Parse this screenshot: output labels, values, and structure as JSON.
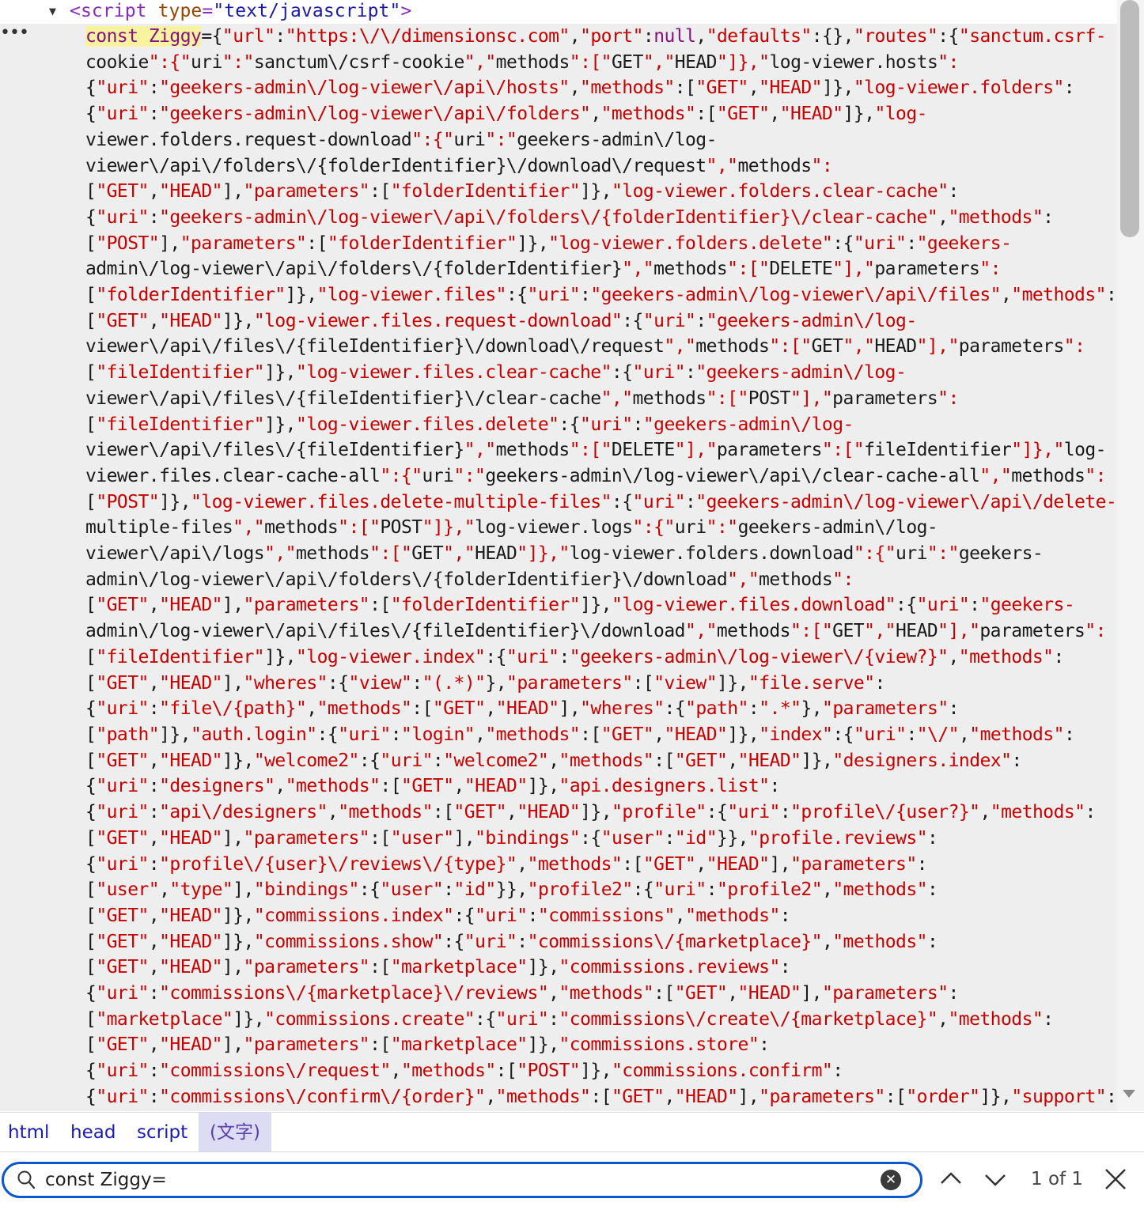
{
  "source_tag": {
    "open": "<script",
    "attr_name": "type",
    "eq": "=",
    "attr_value": "\"text/javascript\"",
    "close": ">"
  },
  "code": {
    "keyword": "const",
    "identifier": "Ziggy",
    "lines": [
      "={\"url\":\"https:\\/\\/dimensionsc.com\",\"port\":null,\"defaults\":{},\"routes\":{\"sanctum.csrf-",
      "cookie\":{\"uri\":\"sanctum\\/csrf-cookie\",\"methods\":[\"GET\",\"HEAD\"]},\"log-viewer.hosts\":",
      "{\"uri\":\"geekers-admin\\/log-viewer\\/api\\/hosts\",\"methods\":[\"GET\",\"HEAD\"]},\"log-viewer.folders\":",
      "{\"uri\":\"geekers-admin\\/log-viewer\\/api\\/folders\",\"methods\":[\"GET\",\"HEAD\"]},\"log-",
      "viewer.folders.request-download\":{\"uri\":\"geekers-admin\\/log-",
      "viewer\\/api\\/folders\\/{folderIdentifier}\\/download\\/request\",\"methods\":",
      "[\"GET\",\"HEAD\"],\"parameters\":[\"folderIdentifier\"]},\"log-viewer.folders.clear-cache\":",
      "{\"uri\":\"geekers-admin\\/log-viewer\\/api\\/folders\\/{folderIdentifier}\\/clear-cache\",\"methods\":",
      "[\"POST\"],\"parameters\":[\"folderIdentifier\"]},\"log-viewer.folders.delete\":{\"uri\":\"geekers-",
      "admin\\/log-viewer\\/api\\/folders\\/{folderIdentifier}\",\"methods\":[\"DELETE\"],\"parameters\":",
      "[\"folderIdentifier\"]},\"log-viewer.files\":{\"uri\":\"geekers-admin\\/log-viewer\\/api\\/files\",\"methods\":",
      "[\"GET\",\"HEAD\"]},\"log-viewer.files.request-download\":{\"uri\":\"geekers-admin\\/log-",
      "viewer\\/api\\/files\\/{fileIdentifier}\\/download\\/request\",\"methods\":[\"GET\",\"HEAD\"],\"parameters\":",
      "[\"fileIdentifier\"]},\"log-viewer.files.clear-cache\":{\"uri\":\"geekers-admin\\/log-",
      "viewer\\/api\\/files\\/{fileIdentifier}\\/clear-cache\",\"methods\":[\"POST\"],\"parameters\":",
      "[\"fileIdentifier\"]},\"log-viewer.files.delete\":{\"uri\":\"geekers-admin\\/log-",
      "viewer\\/api\\/files\\/{fileIdentifier}\",\"methods\":[\"DELETE\"],\"parameters\":[\"fileIdentifier\"]},\"log-",
      "viewer.files.clear-cache-all\":{\"uri\":\"geekers-admin\\/log-viewer\\/api\\/clear-cache-all\",\"methods\":",
      "[\"POST\"]},\"log-viewer.files.delete-multiple-files\":{\"uri\":\"geekers-admin\\/log-viewer\\/api\\/delete-",
      "multiple-files\",\"methods\":[\"POST\"]},\"log-viewer.logs\":{\"uri\":\"geekers-admin\\/log-",
      "viewer\\/api\\/logs\",\"methods\":[\"GET\",\"HEAD\"]},\"log-viewer.folders.download\":{\"uri\":\"geekers-",
      "admin\\/log-viewer\\/api\\/folders\\/{folderIdentifier}\\/download\",\"methods\":",
      "[\"GET\",\"HEAD\"],\"parameters\":[\"folderIdentifier\"]},\"log-viewer.files.download\":{\"uri\":\"geekers-",
      "admin\\/log-viewer\\/api\\/files\\/{fileIdentifier}\\/download\",\"methods\":[\"GET\",\"HEAD\"],\"parameters\":",
      "[\"fileIdentifier\"]},\"log-viewer.index\":{\"uri\":\"geekers-admin\\/log-viewer\\/{view?}\",\"methods\":",
      "[\"GET\",\"HEAD\"],\"wheres\":{\"view\":\"(.*)\"},\"parameters\":[\"view\"]},\"file.serve\":",
      "{\"uri\":\"file\\/{path}\",\"methods\":[\"GET\",\"HEAD\"],\"wheres\":{\"path\":\".*\"},\"parameters\":",
      "[\"path\"]},\"auth.login\":{\"uri\":\"login\",\"methods\":[\"GET\",\"HEAD\"]},\"index\":{\"uri\":\"\\/\",\"methods\":",
      "[\"GET\",\"HEAD\"]},\"welcome2\":{\"uri\":\"welcome2\",\"methods\":[\"GET\",\"HEAD\"]},\"designers.index\":",
      "{\"uri\":\"designers\",\"methods\":[\"GET\",\"HEAD\"]},\"api.designers.list\":",
      "{\"uri\":\"api\\/designers\",\"methods\":[\"GET\",\"HEAD\"]},\"profile\":{\"uri\":\"profile\\/{user?}\",\"methods\":",
      "[\"GET\",\"HEAD\"],\"parameters\":[\"user\"],\"bindings\":{\"user\":\"id\"}},\"profile.reviews\":",
      "{\"uri\":\"profile\\/{user}\\/reviews\\/{type}\",\"methods\":[\"GET\",\"HEAD\"],\"parameters\":",
      "[\"user\",\"type\"],\"bindings\":{\"user\":\"id\"}},\"profile2\":{\"uri\":\"profile2\",\"methods\":",
      "[\"GET\",\"HEAD\"]},\"commissions.index\":{\"uri\":\"commissions\",\"methods\":",
      "[\"GET\",\"HEAD\"]},\"commissions.show\":{\"uri\":\"commissions\\/{marketplace}\",\"methods\":",
      "[\"GET\",\"HEAD\"],\"parameters\":[\"marketplace\"]},\"commissions.reviews\":",
      "{\"uri\":\"commissions\\/{marketplace}\\/reviews\",\"methods\":[\"GET\",\"HEAD\"],\"parameters\":",
      "[\"marketplace\"]},\"commissions.create\":{\"uri\":\"commissions\\/create\\/{marketplace}\",\"methods\":",
      "[\"GET\",\"HEAD\"],\"parameters\":[\"marketplace\"]},\"commissions.store\":",
      "{\"uri\":\"commissions\\/request\",\"methods\":[\"POST\"]},\"commissions.confirm\":",
      "{\"uri\":\"commissions\\/confirm\\/{order}\",\"methods\":[\"GET\",\"HEAD\"],\"parameters\":[\"order\"]},\"support\":"
    ]
  },
  "breadcrumb": {
    "items": [
      "html",
      "head",
      "script",
      "(文字)"
    ]
  },
  "find": {
    "query": "const Ziggy=",
    "match_count": "1 of 1",
    "icons": {
      "search": "search-icon",
      "clear": "clear-icon",
      "prev": "chevron-up-icon",
      "next": "chevron-down-icon",
      "close": "close-icon"
    }
  },
  "colors": {
    "tag": "#8b2bb9",
    "attr_name": "#994500",
    "attr_value": "#1a1aa6",
    "keyword": "#881280",
    "string": "#c80000",
    "highlight": "#f8f3a0",
    "code_bg": "#eeeeee",
    "focus_ring": "#0b57d0",
    "link": "#1b1bb3"
  }
}
